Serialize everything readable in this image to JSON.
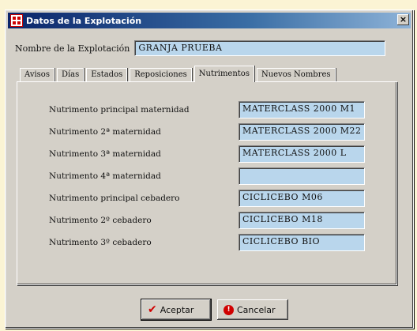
{
  "window": {
    "title": "Datos de la Explotación",
    "close_label": "×"
  },
  "header": {
    "name_label": "Nombre de la Explotación",
    "name_value": "GRANJA PRUEBA"
  },
  "tabs": [
    {
      "label": "Avisos",
      "active": false
    },
    {
      "label": "Días",
      "active": false
    },
    {
      "label": "Estados",
      "active": false
    },
    {
      "label": "Reposiciones",
      "active": false
    },
    {
      "label": "Nutrimentos",
      "active": true
    },
    {
      "label": "Nuevos Nombres",
      "active": false
    }
  ],
  "form": {
    "rows": [
      {
        "label": "Nutrimento principal maternidad",
        "value": "MATERCLASS 2000 M1"
      },
      {
        "label": "Nutrimento 2ª maternidad",
        "value": "MATERCLASS 2000 M22"
      },
      {
        "label": "Nutrimento 3ª maternidad",
        "value": "MATERCLASS 2000 L"
      },
      {
        "label": "Nutrimento 4ª maternidad",
        "value": ""
      },
      {
        "label": "Nutrimento principal cebadero",
        "value": "CICLICEBO M06"
      },
      {
        "label": "Nutrimento 2º cebadero",
        "value": "CICLICEBO M18"
      },
      {
        "label": "Nutrimento 3º cebadero",
        "value": "CICLICEBO BIO"
      }
    ]
  },
  "buttons": {
    "accept_label": "Aceptar",
    "cancel_label": "Cancelar"
  },
  "colors": {
    "field_bg": "#b9d6ec",
    "title_bar": "#0a246a",
    "dialog_bg": "#d4d0c8",
    "page_bg": "#fbf4d4"
  }
}
